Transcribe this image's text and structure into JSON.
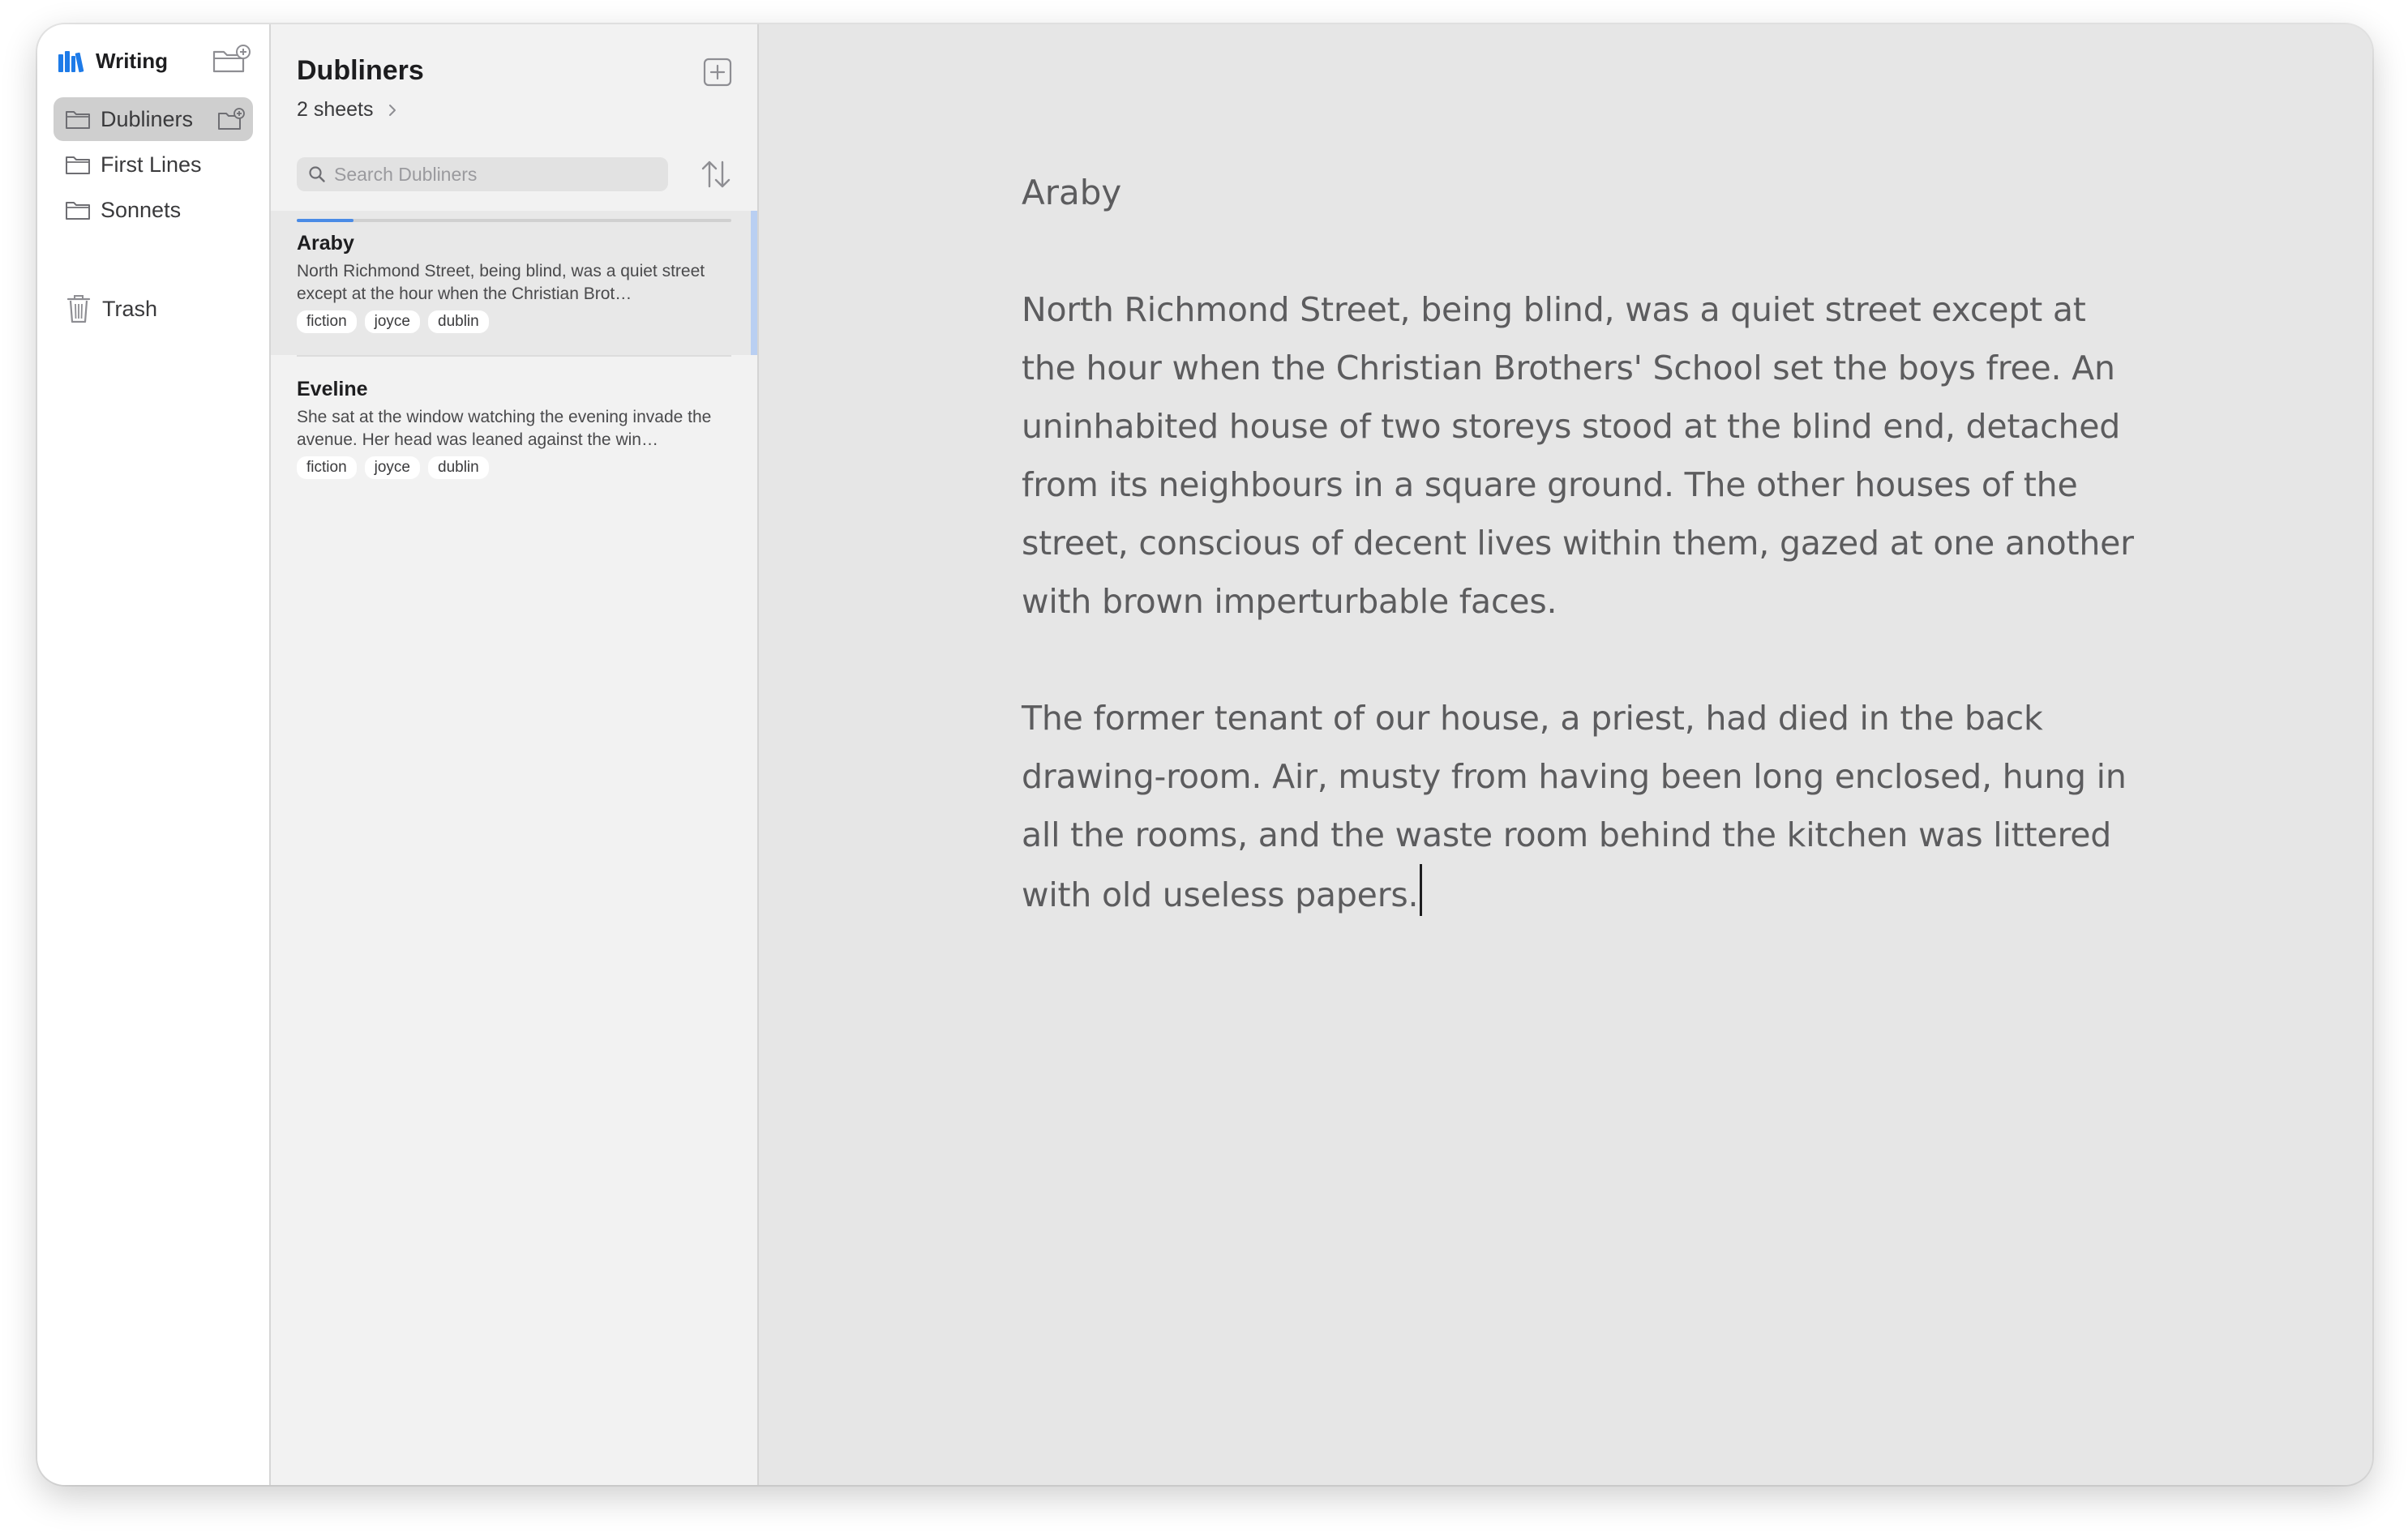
{
  "sidebar": {
    "app_title": "Writing",
    "items": [
      {
        "label": "Dubliners",
        "active": true
      },
      {
        "label": "First Lines",
        "active": false
      },
      {
        "label": "Sonnets",
        "active": false
      }
    ],
    "trash_label": "Trash"
  },
  "list": {
    "title": "Dubliners",
    "count": "2 sheets",
    "search_placeholder": "Search Dubliners",
    "sheets": [
      {
        "title": "Araby",
        "excerpt": "North Richmond Street, being blind, was a quiet street except at the hour when the Christian Brot…",
        "tags": [
          "fiction",
          "joyce",
          "dublin"
        ],
        "progress": 0.13,
        "selected": true
      },
      {
        "title": "Eveline",
        "excerpt": "She sat at the window watching the evening invade the avenue. Her head was leaned against the win…",
        "tags": [
          "fiction",
          "joyce",
          "dublin"
        ],
        "progress": 0,
        "selected": false
      }
    ]
  },
  "editor": {
    "title": "Araby",
    "paragraphs": [
      "North Richmond Street, being blind, was a quiet street except at the hour when the Christian Brothers' School set the boys free. An uninhabited house of two storeys stood at the blind end, detached from its neighbours in a square ground. The other houses of the street, conscious of decent lives within them, gazed at one another with brown imperturbable faces.",
      "The former tenant of our house, a priest, had died in the back drawing-room. Air, musty from having been long enclosed, hung in all the rooms, and the waste room behind the kitchen was littered with old useless papers."
    ]
  },
  "colors": {
    "accent": "#4a8be6",
    "app_icon": "#1e7be8",
    "selection_bar": "#b9cff2"
  }
}
